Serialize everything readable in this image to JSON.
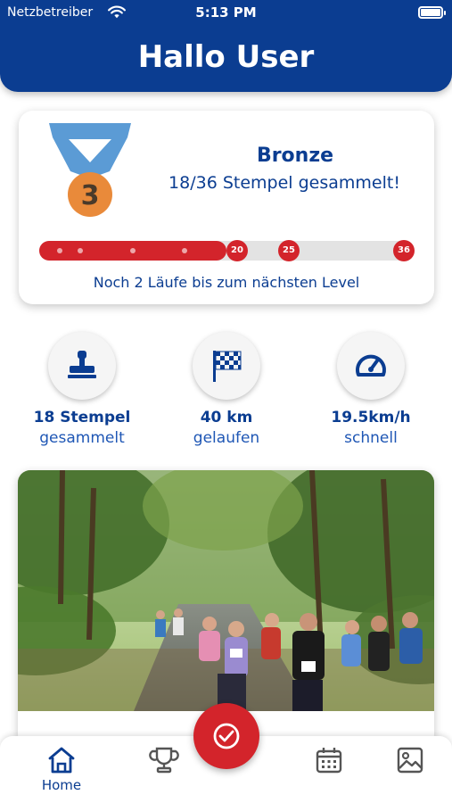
{
  "status_bar": {
    "carrier": "Netzbetreiber",
    "time": "5:13 PM",
    "wifi_icon": "wifi-icon",
    "battery_icon": "battery-icon"
  },
  "header": {
    "title": "Hallo User",
    "background": "#0b3d91"
  },
  "level_card": {
    "medal_number": "3",
    "level_name": "Bronze",
    "stamp_count_text": "18/36 Stempel gesammelt!",
    "progress": {
      "value": 18,
      "max": 36,
      "fill_fraction": 0.5,
      "milestones": [
        "20",
        "25",
        "36"
      ]
    },
    "hint": "Noch 2 Läufe bis zum nächsten Level"
  },
  "stats": [
    {
      "icon": "stamp-icon",
      "value": "18 Stempel",
      "label": "gesammelt"
    },
    {
      "icon": "checkered-flag-icon",
      "value": "40 km",
      "label": "gelaufen"
    },
    {
      "icon": "speedometer-icon",
      "value": "19.5km/h",
      "label": "schnell"
    }
  ],
  "photo": {
    "description_icon": "runners-photo"
  },
  "tab_bar": {
    "items": [
      {
        "icon": "home-icon",
        "label": "Home",
        "active": true
      },
      {
        "icon": "trophy-icon",
        "label": ""
      },
      {
        "icon": "checkmark-circle-icon",
        "label": ""
      },
      {
        "icon": "calendar-icon",
        "label": ""
      },
      {
        "icon": "gallery-icon",
        "label": ""
      }
    ]
  },
  "colors": {
    "primary": "#0b3d91",
    "accent": "#d3242b",
    "medal": "#e98a3a",
    "ribbon": "#5b9bd5"
  }
}
